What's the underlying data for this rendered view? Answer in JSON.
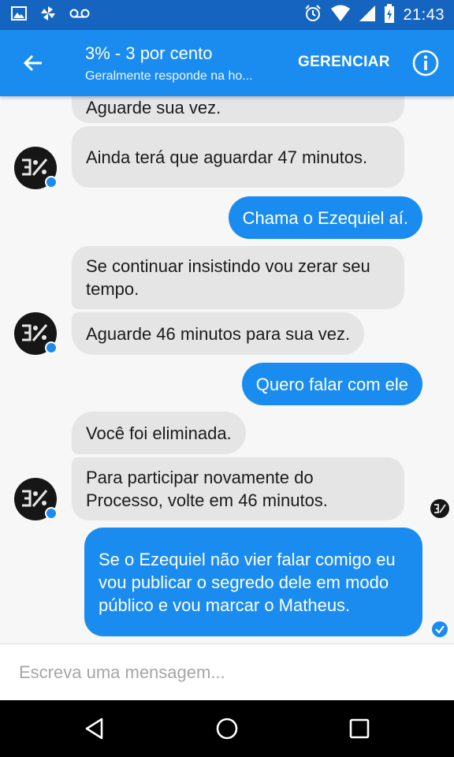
{
  "status_bar": {
    "time": "21:43",
    "left_icons": [
      "gallery-icon",
      "pinwheel-icon",
      "voicemail-icon"
    ],
    "right_icons": [
      "alarm-icon",
      "wifi-icon",
      "signal-icon",
      "battery-icon"
    ]
  },
  "header": {
    "title": "3% - 3 por cento",
    "subtitle": "Geralmente responde na ho...",
    "manage_label": "GERENCIAR"
  },
  "messages": [
    {
      "direction": "in",
      "text": "Aguarde sua vez."
    },
    {
      "direction": "in",
      "text": "Ainda terá que aguardar 47 minutos."
    },
    {
      "direction": "out",
      "text": "Chama o Ezequiel aí."
    },
    {
      "direction": "in",
      "text": "Se continuar insistindo vou zerar seu tempo."
    },
    {
      "direction": "in",
      "text": "Aguarde 46 minutos para sua vez."
    },
    {
      "direction": "out",
      "text": "Quero falar com ele"
    },
    {
      "direction": "in",
      "text": "Você foi eliminada."
    },
    {
      "direction": "in",
      "text": "Para participar novamente do Processo, volte em 46 minutos."
    },
    {
      "direction": "out",
      "text": "Se o Ezequiel não vier falar comigo eu vou publicar o segredo dele em modo público e vou marcar o Matheus."
    }
  ],
  "composer": {
    "placeholder": "Escreva uma mensagem..."
  },
  "nav_bar": {
    "buttons": [
      "back-triangle-icon",
      "home-circle-icon",
      "recents-square-icon"
    ]
  },
  "colors": {
    "status_bar": "#1565c0",
    "app_bar": "#1a8cf0",
    "outgoing_bubble": "#1a8cf0",
    "incoming_bubble": "#e5e5e5",
    "chat_background": "#f7f7f7"
  }
}
